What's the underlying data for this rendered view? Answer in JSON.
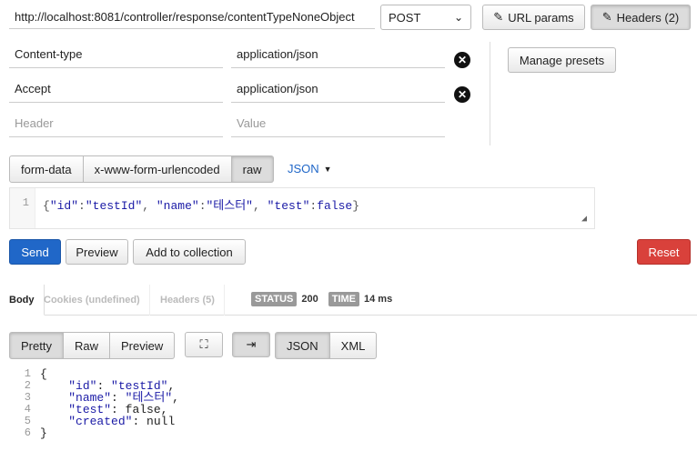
{
  "request": {
    "url": "http://localhost:8081/controller/response/contentTypeNoneObject",
    "method": "POST",
    "url_params_label": "URL params",
    "headers_label": "Headers (2)"
  },
  "headers": [
    {
      "key": "Content-type",
      "value": "application/json"
    },
    {
      "key": "Accept",
      "value": "application/json"
    }
  ],
  "header_placeholder": {
    "key": "Header",
    "value": "Value"
  },
  "manage_presets_label": "Manage presets",
  "body_tabs": [
    "form-data",
    "x-www-form-urlencoded",
    "raw"
  ],
  "body_format": "JSON",
  "editor": {
    "line_number": "1",
    "tokens": [
      "{",
      "\"id\"",
      ":",
      "\"testId\"",
      ", ",
      "\"name\"",
      ":",
      "\"테스터\"",
      ", ",
      "\"test\"",
      ":",
      "false",
      "}"
    ]
  },
  "actions": {
    "send": "Send",
    "preview": "Preview",
    "add_to_collection": "Add to collection",
    "reset": "Reset"
  },
  "response_tabs": {
    "body": "Body",
    "cookies": "Cookies (undefined)",
    "headers": "Headers (5)"
  },
  "status": {
    "label": "STATUS",
    "value": "200"
  },
  "time": {
    "label": "TIME",
    "value": "14 ms"
  },
  "view_modes": [
    "Pretty",
    "Raw",
    "Preview"
  ],
  "format_modes": [
    "JSON",
    "XML"
  ],
  "response_lines": [
    "1",
    "2",
    "3",
    "4",
    "5",
    "6"
  ],
  "response_body": {
    "l1": "{",
    "id_key": "\"id\"",
    "id_val": "\"testId\"",
    "name_key": "\"name\"",
    "name_val": "\"테스터\"",
    "test_key": "\"test\"",
    "test_val": "false",
    "created_key": "\"created\"",
    "created_val": "null",
    "l6": "}"
  },
  "icons": {
    "url_params": "edit-icon",
    "headers": "edit-icon",
    "remove_header": "close-circle-icon",
    "dropdown": "chevron-down-icon",
    "fullscreen": "fullscreen-icon",
    "wrap": "wrap-icon"
  },
  "colors": {
    "send": "#2067c8",
    "reset": "#d9413b",
    "json_key": "#1a1aa6"
  }
}
